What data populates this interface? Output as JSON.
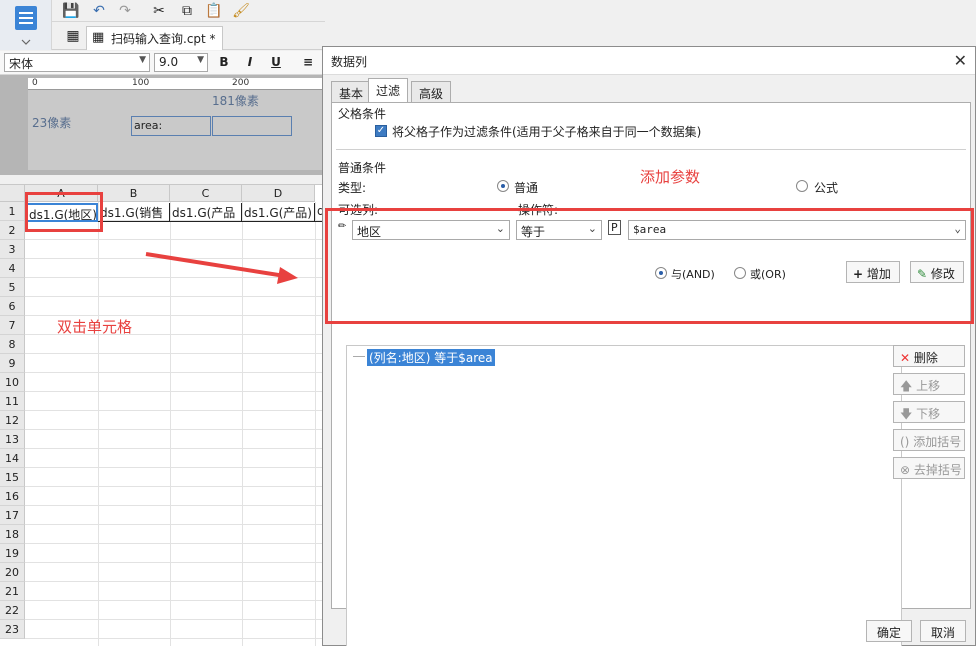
{
  "designer": {
    "doc_tab_label": "扫码输入查询.cpt *",
    "font_name": "宋体",
    "font_size": "9.0",
    "bold": "B",
    "italic": "I",
    "underline": "U",
    "ruler_ticks": [
      "0",
      "100",
      "200"
    ],
    "width_px": "181像素",
    "height_px": "23像素",
    "preview_cell_text": "area:",
    "columns": [
      "A",
      "B",
      "C",
      "D"
    ],
    "rows": [
      "1",
      "2",
      "3",
      "4",
      "5",
      "6",
      "7",
      "8",
      "9",
      "10",
      "11",
      "12",
      "13",
      "14",
      "15",
      "16",
      "17",
      "18",
      "19",
      "20",
      "21",
      "22",
      "23"
    ],
    "row1_cells": [
      "ds1.G(地区)",
      "ds1.G(销售",
      "ds1.G(产品",
      "ds1.G(产品)",
      "d"
    ],
    "annotation_double_click": "双击单元格"
  },
  "dialog": {
    "title": "数据列",
    "tabs": [
      "基本",
      "过滤",
      "高级"
    ],
    "active_tab": "过滤",
    "parent_condition_label": "父格条件",
    "parent_checkbox_label": "将父格子作为过滤条件(适用于父子格来自于同一个数据集)",
    "normal_condition_label": "普通条件",
    "type_label": "类型:",
    "type_normal": "普通",
    "type_formula": "公式",
    "available_col_label": "可选列:",
    "operator_label": "操作符:",
    "column_value": "地区",
    "operator_value": "等于",
    "param_value": "$area",
    "and_label": "与(AND)",
    "or_label": "或(OR)",
    "add_btn": "增加",
    "modify_btn": "修改",
    "delete_btn": "删除",
    "up_btn": "上移",
    "down_btn": "下移",
    "add_bracket_btn": "添加括号",
    "remove_bracket_btn": "去掉括号",
    "condition_item": "(列名:地区) 等于$area",
    "ok_btn": "确定",
    "cancel_btn": "取消",
    "annotation_add_param": "添加参数"
  },
  "colors": {
    "accent": "#e8413f",
    "selection": "#3b84d6"
  }
}
